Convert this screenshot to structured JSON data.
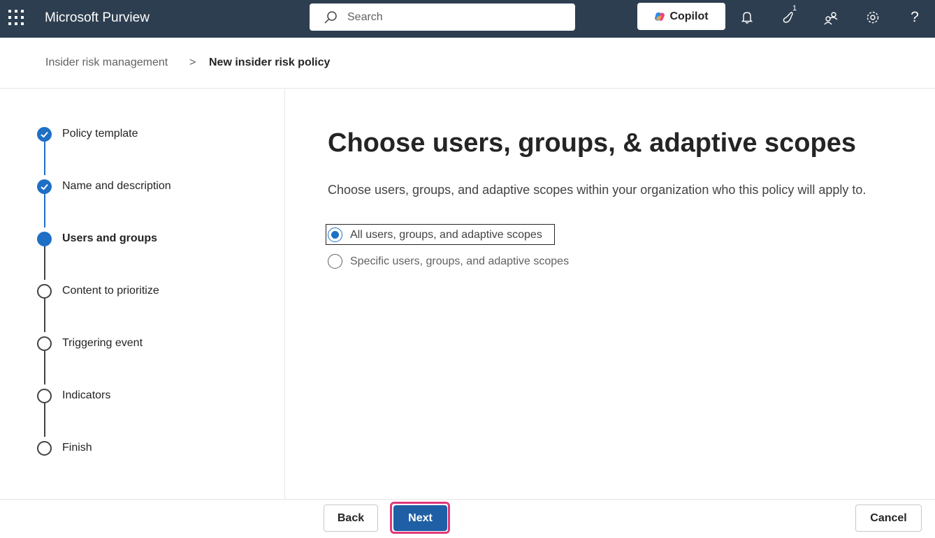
{
  "app": {
    "title": "Microsoft Purview",
    "waffle_icon": "app-launcher-icon"
  },
  "search": {
    "placeholder": "Search",
    "icon": "search-icon"
  },
  "copilot": {
    "label": "Copilot"
  },
  "header_icons": {
    "notifications": "bell-icon",
    "whats_new": "megaphone-icon",
    "whats_new_count": "1",
    "community": "people-icon",
    "settings": "gear-icon",
    "help": "?"
  },
  "breadcrumb": {
    "parent": "Insider risk management",
    "separator": ">",
    "current": "New insider risk policy"
  },
  "steps": [
    {
      "label": "Policy template",
      "state": "done"
    },
    {
      "label": "Name and description",
      "state": "done"
    },
    {
      "label": "Users and groups",
      "state": "current"
    },
    {
      "label": "Content to prioritize",
      "state": "todo"
    },
    {
      "label": "Triggering event",
      "state": "todo"
    },
    {
      "label": "Indicators",
      "state": "todo"
    },
    {
      "label": "Finish",
      "state": "todo"
    }
  ],
  "main": {
    "heading": "Choose users, groups, & adaptive scopes",
    "description": "Choose users, groups, and adaptive scopes within your organization who this policy will apply to.",
    "options": [
      {
        "label": "All users, groups, and adaptive scopes",
        "selected": true
      },
      {
        "label": "Specific users, groups, and adaptive scopes",
        "selected": false
      }
    ]
  },
  "footer": {
    "back_label": "Back",
    "next_label": "Next",
    "cancel_label": "Cancel"
  },
  "colors": {
    "topbar": "#2d3e50",
    "accent": "#1f6fc5",
    "next_button": "#1f5fa5",
    "highlight_ring": "#e0397a"
  }
}
